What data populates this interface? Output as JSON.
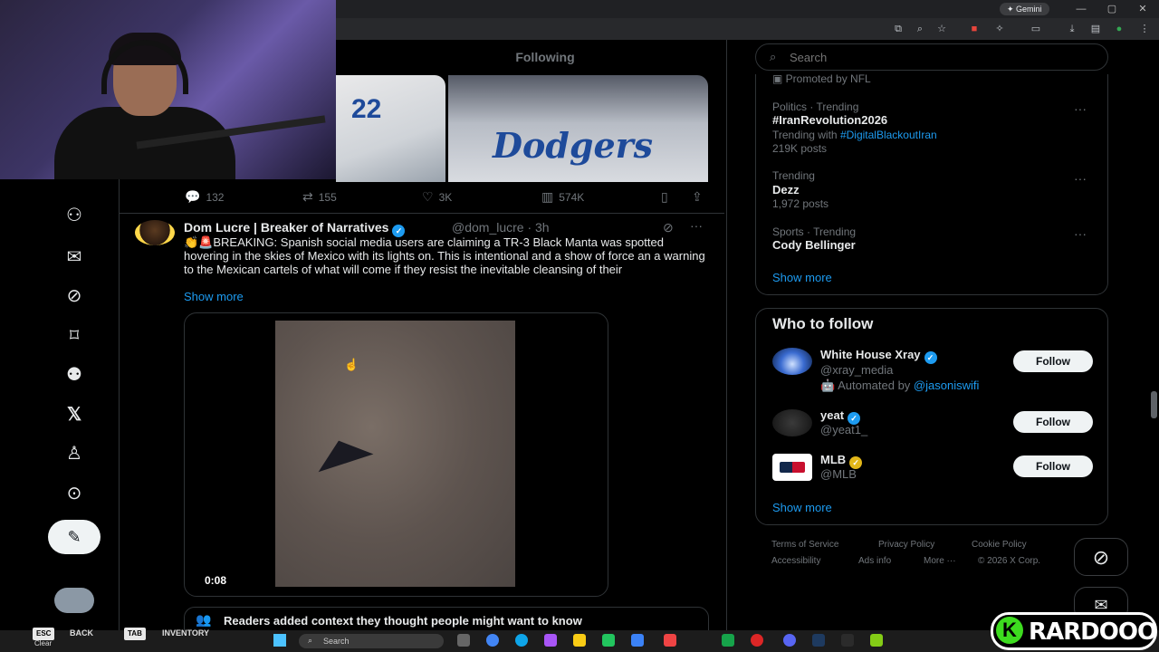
{
  "browser": {
    "gemini_label": "✦ Gemini",
    "controls": [
      "—",
      "▢",
      "✕"
    ]
  },
  "feed": {
    "active_tab": "Following"
  },
  "prev_tweet": {
    "jersey_number": "22",
    "team_script": "Dodgers",
    "replies": "132",
    "reposts": "155",
    "likes": "3K",
    "views": "574K"
  },
  "tweet": {
    "author_name": "Dom Lucre | Breaker of Narratives",
    "author_handle": "@dom_lucre · 3h",
    "text": "👏🚨BREAKING: Spanish social media users are claiming a TR-3 Black Manta was spotted hovering in the skies of Mexico with its lights on. This is intentional and a show of force an a warning to the Mexican cartels of what will come if they resist the inevitable cleansing of their",
    "show_more": "Show more",
    "video_time": "0:08",
    "context_note": "Readers added context they thought people might want to know"
  },
  "search": {
    "placeholder": "Search"
  },
  "trends": {
    "promoted": "Promoted by NFL",
    "items": [
      {
        "meta": "Politics · Trending",
        "title": "#IranRevolution2026",
        "extra_prefix": "Trending with ",
        "extra_link": "#DigitalBlackoutIran",
        "posts": "219K posts"
      },
      {
        "meta": "Trending",
        "title": "Dezz",
        "posts": "1,972 posts"
      },
      {
        "meta": "Sports · Trending",
        "title": "Cody Bellinger"
      }
    ],
    "show_more": "Show more",
    "more_glyph": "···"
  },
  "who_to_follow": {
    "title": "Who to follow",
    "follow_label": "Follow",
    "accounts": [
      {
        "name": "White House Xray",
        "handle": "@xray_media",
        "automated_prefix": "Automated by ",
        "automated_link": "@jasoniswifi"
      },
      {
        "name": "yeat",
        "handle": "@yeat1_"
      },
      {
        "name": "MLB",
        "handle": "@MLB"
      }
    ],
    "show_more": "Show more"
  },
  "footer": {
    "links": [
      "Terms of Service",
      "Privacy Policy",
      "Cookie Policy",
      "Accessibility",
      "Ads info",
      "More ···",
      "© 2026 X Corp."
    ]
  },
  "taskbar": {
    "clear_label": "Clear",
    "esc_key": "ESC",
    "back_label": "BACK",
    "tab_key": "TAB",
    "inventory_label": "INVENTORY",
    "search_label": "Search"
  },
  "brand": {
    "letter": "K",
    "name": "RARDOOO"
  },
  "colors": {
    "accent": "#1d9bf0",
    "background": "#000000",
    "border": "#2f3336",
    "muted_text": "#71767b",
    "brand_green": "#3ddc1f"
  }
}
